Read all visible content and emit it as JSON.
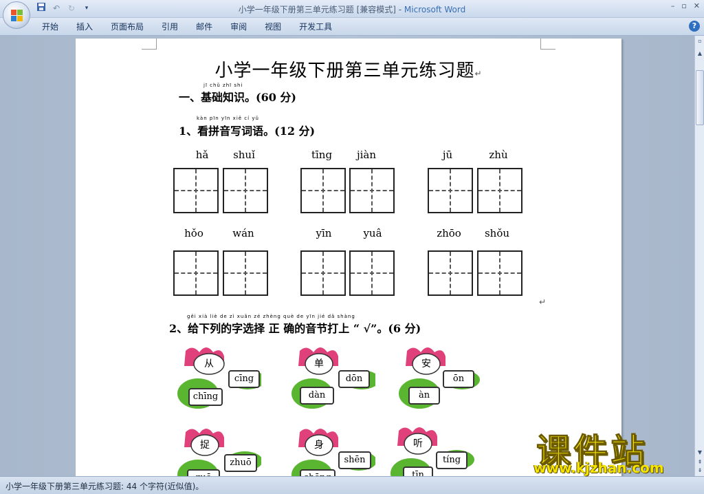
{
  "window": {
    "title": "小学一年级下册第三单元练习题 [兼容模式] - ",
    "app_name": "Microsoft Word",
    "controls": [
      "–",
      "▫",
      "✕"
    ]
  },
  "ribbon": {
    "tabs": [
      "开始",
      "插入",
      "页面布局",
      "引用",
      "邮件",
      "审阅",
      "视图",
      "开发工具"
    ],
    "help": "?"
  },
  "document": {
    "title": "小学一年级下册第三单元练习题",
    "para_mark": "↵",
    "section1": {
      "ruby": "jī chǔ zhī shi",
      "heading": "一、基础知识。(60 分)"
    },
    "q1": {
      "ruby": "kàn pīn yīn xiě cí yǔ",
      "heading": "1、看拼音写词语。(12 分)",
      "row1": [
        "hǎ",
        "shuǐ",
        "tīng",
        "jiàn",
        "jū",
        "zhù"
      ],
      "row2": [
        "hǒo",
        "wán",
        "yīn",
        "yuâ",
        "zhōo",
        "shǒu"
      ]
    },
    "q2": {
      "ruby": "gěi xià liè de zì xuǎn zé zhèng què de yīn jié dǎ shàng",
      "heading": "2、给下列的字选择 正 确的音节打上 “ √”。(6 分)",
      "items": [
        {
          "char": "从",
          "opt_a": "cīng",
          "opt_b": "chīng"
        },
        {
          "char": "单",
          "opt_a": "dōn",
          "opt_b": "dàn"
        },
        {
          "char": "安",
          "opt_a": "ōn",
          "opt_b": "àn"
        },
        {
          "char": "捉",
          "opt_a": "zhuō",
          "opt_b": "zuō"
        },
        {
          "char": "身",
          "opt_a": "shēn",
          "opt_b": "shēng"
        },
        {
          "char": "听",
          "opt_a": "tíng",
          "opt_b": "tīn"
        }
      ]
    }
  },
  "status": {
    "text": "小学一年级下册第三单元练习题: 44 个字符(近似值)。"
  },
  "watermark": {
    "title": "课件站",
    "url": "www.kjzhan.com"
  },
  "colors": {
    "lotus_petal": "#e0417a",
    "leaf": "#5ab531",
    "watermark": "#f5e400"
  }
}
